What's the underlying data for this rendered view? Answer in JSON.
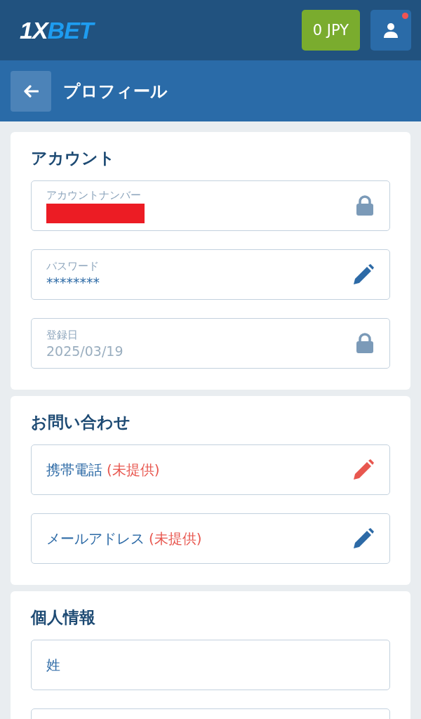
{
  "header": {
    "logo": {
      "part_1": "1X",
      "part_2": "BET"
    },
    "balance": "0 JPY",
    "notification": true
  },
  "page_title": "プロフィール",
  "sections": [
    {
      "title": "アカウント",
      "fields": [
        {
          "kind": "labeled",
          "label": "アカウントナンバー",
          "redacted": true,
          "locked": true
        },
        {
          "kind": "labeled",
          "label": "パスワード",
          "value": "********",
          "redacted": false,
          "locked": false,
          "alert": false
        },
        {
          "kind": "labeled",
          "label": "登録日",
          "value": "2025/03/19",
          "redacted": false,
          "locked": true
        }
      ]
    },
    {
      "title": "お問い合わせ",
      "fields": [
        {
          "kind": "plain",
          "text": "携帯電話",
          "note": "(未提供)",
          "locked": false,
          "alert": true
        },
        {
          "kind": "plain",
          "text": "メールアドレス",
          "note": "(未提供)",
          "locked": false,
          "alert": false
        }
      ]
    },
    {
      "title": "個人情報",
      "fields": [
        {
          "kind": "plain",
          "text": "姓"
        },
        {
          "kind": "plain"
        }
      ]
    }
  ]
}
